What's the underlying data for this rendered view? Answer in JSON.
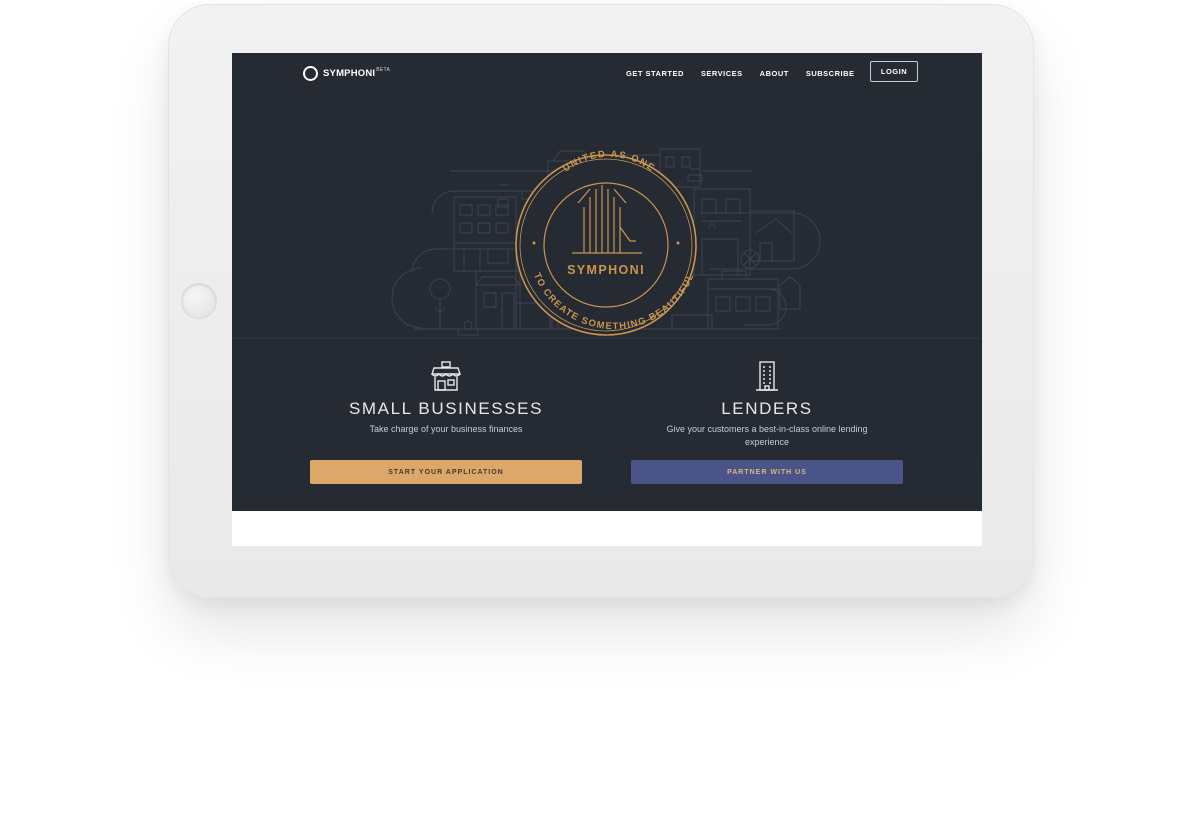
{
  "brand": {
    "name": "SYMPHONI",
    "beta": "BETA"
  },
  "nav": {
    "links": [
      "GET STARTED",
      "SERVICES",
      "ABOUT",
      "SUBSCRIBE"
    ],
    "login": "LOGIN"
  },
  "seal": {
    "top_text": "UNITED AS ONE",
    "name": "SYMPHONI",
    "bottom_text": "TO CREATE SOMETHING BEAUTIFUL"
  },
  "columns": {
    "small": {
      "icon": "storefront-icon",
      "title": "SMALL BUSINESSES",
      "subtitle": "Take charge of your business finances",
      "cta": "START YOUR APPLICATION"
    },
    "lenders": {
      "icon": "office-building-icon",
      "title": "LENDERS",
      "subtitle": "Give your customers a best-in-class online lending experience",
      "cta": "PARTNER WITH US"
    }
  },
  "colors": {
    "background": "#252a33",
    "gold": "#c9964f",
    "cta_gold": "#dba86a",
    "cta_blue": "#4a5489",
    "line_art": "#3f4654"
  }
}
